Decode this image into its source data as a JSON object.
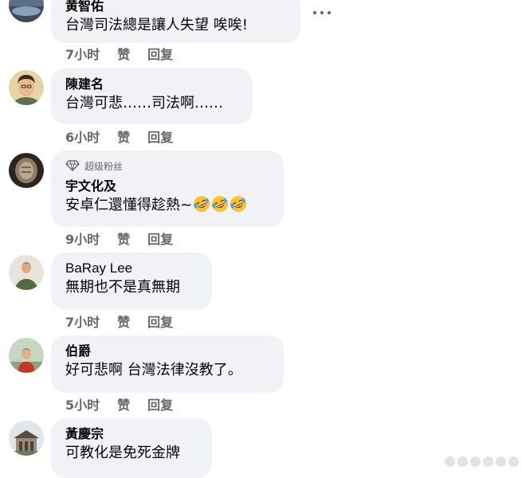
{
  "actions": {
    "like_label": "赞",
    "reply_label": "回复"
  },
  "comments": [
    {
      "author": "黄智佑",
      "text": "台灣司法總是讓人失望 唉唉!",
      "time": "7小时"
    },
    {
      "author": "陳建名",
      "text": "台灣可悲……司法啊……",
      "time": "6小时"
    },
    {
      "badge": "超级粉丝",
      "author": "宇文化及",
      "text": "安卓仁還懂得趁熱~",
      "emoji": [
        "rolling-on-floor-laughing",
        "rolling-on-floor-laughing",
        "rolling-on-floor-laughing"
      ],
      "time": "9小时"
    },
    {
      "author": "BaRay Lee",
      "text": "無期也不是真無期",
      "time": "7小时"
    },
    {
      "author": "伯爵",
      "text": "好可悲啊 台灣法律沒教了。",
      "time": "5小时"
    },
    {
      "author": "黃慶宗",
      "text": "可教化是免死金牌"
    }
  ],
  "colors": {
    "bubble_bg": "#f0f2f5",
    "secondary_text": "#65676b",
    "primary_text": "#050505"
  }
}
